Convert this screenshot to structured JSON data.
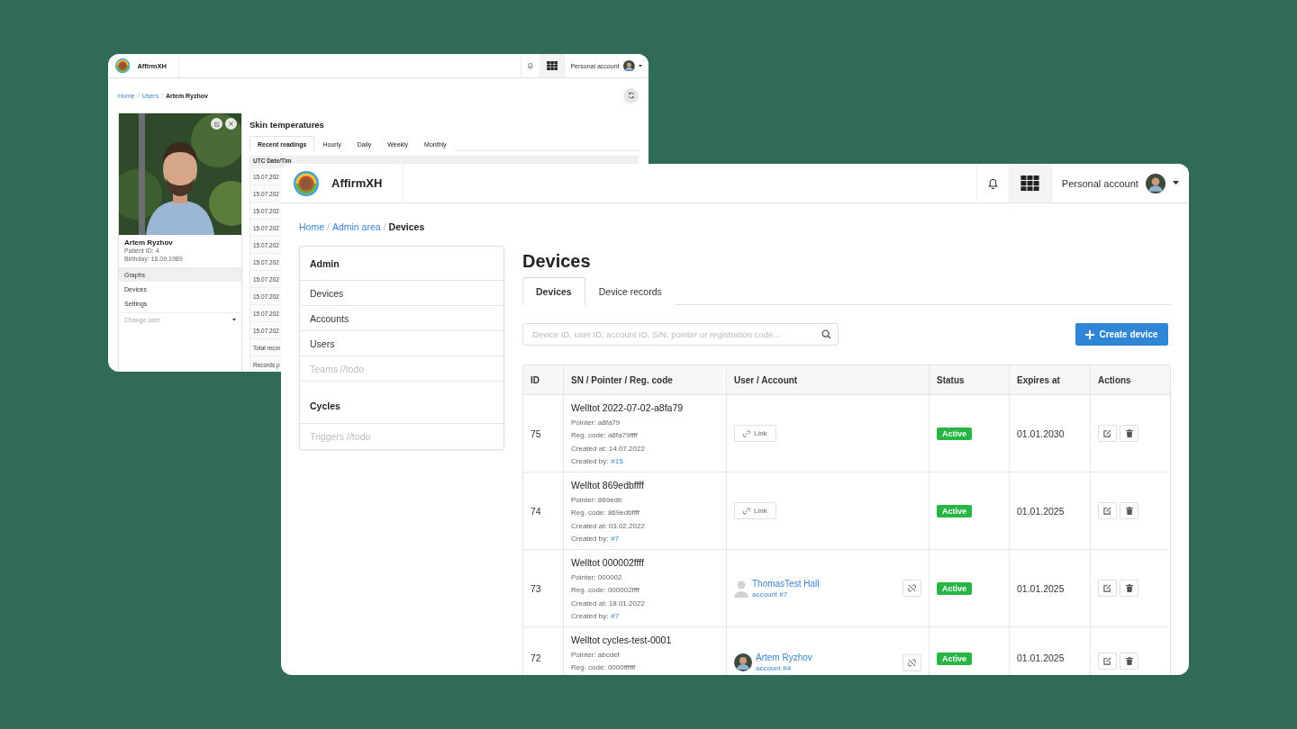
{
  "back_window": {
    "header": {
      "brand": "AffirmXH",
      "account_label": "Personal account"
    },
    "breadcrumb": {
      "separator": "/",
      "items": [
        {
          "label": "Home",
          "link": true
        },
        {
          "label": "Users",
          "link": true
        },
        {
          "label": "Artem Ryzhov",
          "link": false
        }
      ]
    },
    "profile": {
      "name": "Artem Ryzhov",
      "details": [
        "Patient ID: 4",
        "Birthday: 16.09.1989"
      ],
      "menu": [
        {
          "label": "Graphs",
          "selected": true
        },
        {
          "label": "Devices",
          "selected": false
        },
        {
          "label": "Settings",
          "selected": false
        }
      ],
      "change_user_placeholder": "Change user"
    },
    "section_title": "Skin temperatures",
    "tabs": [
      {
        "label": "Recent readings",
        "selected": true
      },
      {
        "label": "Hourly",
        "selected": false
      },
      {
        "label": "Daily",
        "selected": false
      },
      {
        "label": "Weekly",
        "selected": false
      },
      {
        "label": "Monthly",
        "selected": false
      }
    ],
    "table": {
      "column_1": "UTC Date/Tim",
      "rows": [
        "15.07.202",
        "15.07.202",
        "15.07.202",
        "15.07.202",
        "15.07.202",
        "15.07.202",
        "15.07.202",
        "15.07.202",
        "15.07.202",
        "15.07.202"
      ],
      "footer": [
        "Total recor",
        "Records p"
      ]
    }
  },
  "front_window": {
    "header": {
      "brand": "AffirmXH",
      "account_label": "Personal account"
    },
    "breadcrumb": {
      "separator": "/",
      "items": [
        {
          "label": "Home",
          "link": true
        },
        {
          "label": "Admin area",
          "link": true
        },
        {
          "label": "Devices",
          "link": false
        }
      ]
    },
    "sidebar": {
      "groups": [
        {
          "title": "Admin",
          "items": [
            {
              "label": "Devices",
              "disabled": false
            },
            {
              "label": "Accounts",
              "disabled": false
            },
            {
              "label": "Users",
              "disabled": false
            },
            {
              "label": "Teams //todo",
              "disabled": true
            }
          ]
        },
        {
          "title": "Cycles",
          "items": [
            {
              "label": "Triggers //todo",
              "disabled": true
            }
          ]
        }
      ]
    },
    "title": "Devices",
    "tabs": [
      {
        "label": "Devices",
        "selected": true
      },
      {
        "label": "Device records",
        "selected": false
      }
    ],
    "search": {
      "placeholder": "Device ID, user ID, account ID, S/N, pointer or registration code..."
    },
    "create_button": "Create device",
    "table": {
      "columns": [
        "ID",
        "SN / Pointer / Reg. code",
        "User / Account",
        "Status",
        "Expires at",
        "Actions"
      ],
      "rows": [
        {
          "id": "75",
          "name": "Welltot 2022-07-02-a8fa79",
          "details": [
            {
              "label": "Pointer: a8fa79"
            },
            {
              "label": "Reg. code: a8fa79ffff"
            },
            {
              "label": "Created at: 14.07.2022"
            },
            {
              "label": "Created by:",
              "link": "#15"
            }
          ],
          "user": {
            "kind": "link",
            "label": "Link"
          },
          "status": "Active",
          "expires": "01.01.2030"
        },
        {
          "id": "74",
          "name": "Welltot 869edbffff",
          "details": [
            {
              "label": "Pointer: 869edb"
            },
            {
              "label": "Reg. code: 869edbffff"
            },
            {
              "label": "Created at: 03.02.2022"
            },
            {
              "label": "Created by:",
              "link": "#7"
            }
          ],
          "user": {
            "kind": "link",
            "label": "Link"
          },
          "status": "Active",
          "expires": "01.01.2025"
        },
        {
          "id": "73",
          "name": "Welltot 000002ffff",
          "details": [
            {
              "label": "Pointer: 000002"
            },
            {
              "label": "Reg. code: 000002ffff"
            },
            {
              "label": "Created at: 18.01.2022"
            },
            {
              "label": "Created by:",
              "link": "#7"
            }
          ],
          "user": {
            "kind": "account",
            "has_photo": false,
            "name": "ThomasTest Hall",
            "account": "account #7"
          },
          "status": "Active",
          "expires": "01.01.2025"
        },
        {
          "id": "72",
          "name": "Welltot cycles-test-0001",
          "details": [
            {
              "label": "Pointer: abcdef"
            },
            {
              "label": "Reg. code: 0000ffffff"
            }
          ],
          "user": {
            "kind": "account",
            "has_photo": true,
            "name": "Artem Ryzhov",
            "account": "account #4"
          },
          "status": "Active",
          "expires": "01.01.2025"
        }
      ]
    }
  }
}
